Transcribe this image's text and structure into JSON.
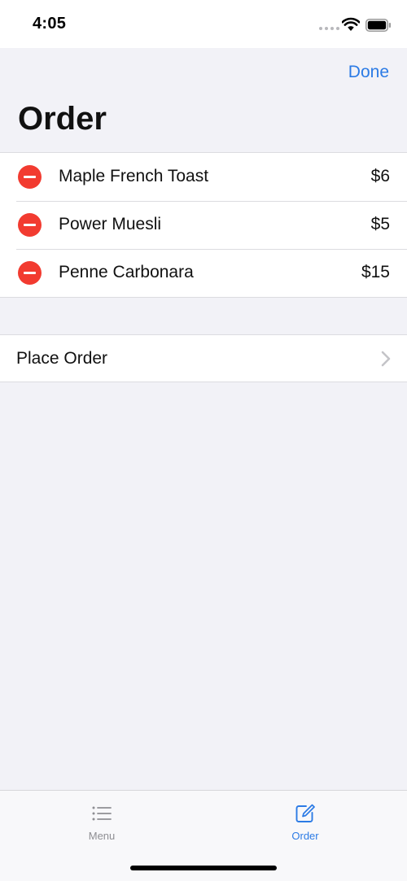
{
  "status_bar": {
    "time": "4:05"
  },
  "nav": {
    "done_label": "Done",
    "title": "Order"
  },
  "order": {
    "items": [
      {
        "name": "Maple French Toast",
        "price": "$6"
      },
      {
        "name": "Power Muesli",
        "price": "$5"
      },
      {
        "name": "Penne Carbonara",
        "price": "$15"
      }
    ]
  },
  "actions": {
    "place_order_label": "Place Order"
  },
  "tab_bar": {
    "tabs": [
      {
        "label": "Menu",
        "icon": "list-icon",
        "selected": false
      },
      {
        "label": "Order",
        "icon": "compose-icon",
        "selected": true
      }
    ]
  },
  "colors": {
    "accent": "#2c7be5",
    "delete": "#f23b30",
    "background": "#f2f2f7"
  }
}
